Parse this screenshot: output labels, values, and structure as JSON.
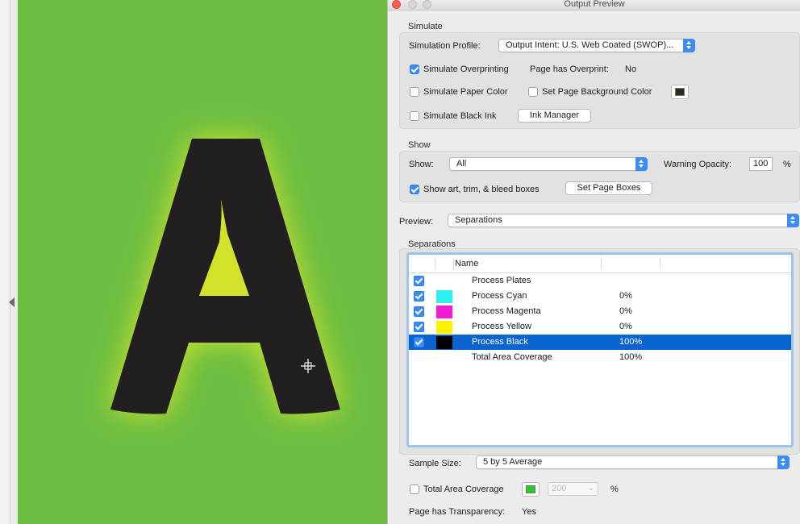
{
  "window": {
    "title": "Output Preview"
  },
  "simulate": {
    "group_label": "Simulate",
    "profile_label": "Simulation Profile:",
    "profile_value": "Output Intent: U.S. Web Coated (SWOP)...",
    "overprinting_label": "Simulate Overprinting",
    "overprinting_checked": true,
    "page_overprint_label": "Page has Overprint:",
    "page_overprint_value": "No",
    "paper_color_label": "Simulate Paper Color",
    "page_bg_label": "Set Page Background Color",
    "black_ink_label": "Simulate Black Ink",
    "ink_manager_label": "Ink Manager"
  },
  "show": {
    "group_label": "Show",
    "show_label": "Show:",
    "show_value": "All",
    "warning_label": "Warning Opacity:",
    "warning_value": "100",
    "warning_unit": "%",
    "boxes_label": "Show art, trim, & bleed boxes",
    "boxes_checked": true,
    "set_boxes_label": "Set Page Boxes"
  },
  "preview": {
    "label": "Preview:",
    "value": "Separations"
  },
  "separations": {
    "group_label": "Separations",
    "column_name": "Name",
    "rows": [
      {
        "name": "Process Plates",
        "percent": "",
        "color": "",
        "checked": true,
        "selected": false
      },
      {
        "name": "Process Cyan",
        "percent": "0%",
        "color": "#2ef2f2",
        "checked": true,
        "selected": false
      },
      {
        "name": "Process Magenta",
        "percent": "0%",
        "color": "#f21ad6",
        "checked": true,
        "selected": false
      },
      {
        "name": "Process Yellow",
        "percent": "0%",
        "color": "#fff200",
        "checked": true,
        "selected": false
      },
      {
        "name": "Process Black",
        "percent": "100%",
        "color": "#000000",
        "checked": true,
        "selected": true
      },
      {
        "name": "Total Area Coverage",
        "percent": "100%",
        "color": "",
        "checked": false,
        "selected": false
      }
    ]
  },
  "sample": {
    "label": "Sample Size:",
    "value": "5 by 5 Average"
  },
  "coverage": {
    "label": "Total Area Coverage",
    "value": "200",
    "unit": "%",
    "swatch_color": "#22cc22"
  },
  "transparency": {
    "label": "Page has Transparency:",
    "value": "Yes"
  },
  "artwork": {
    "letter": "A",
    "background_color": "#6cbd42",
    "glow_color": "#d4e62a",
    "letter_color": "#231f20"
  }
}
